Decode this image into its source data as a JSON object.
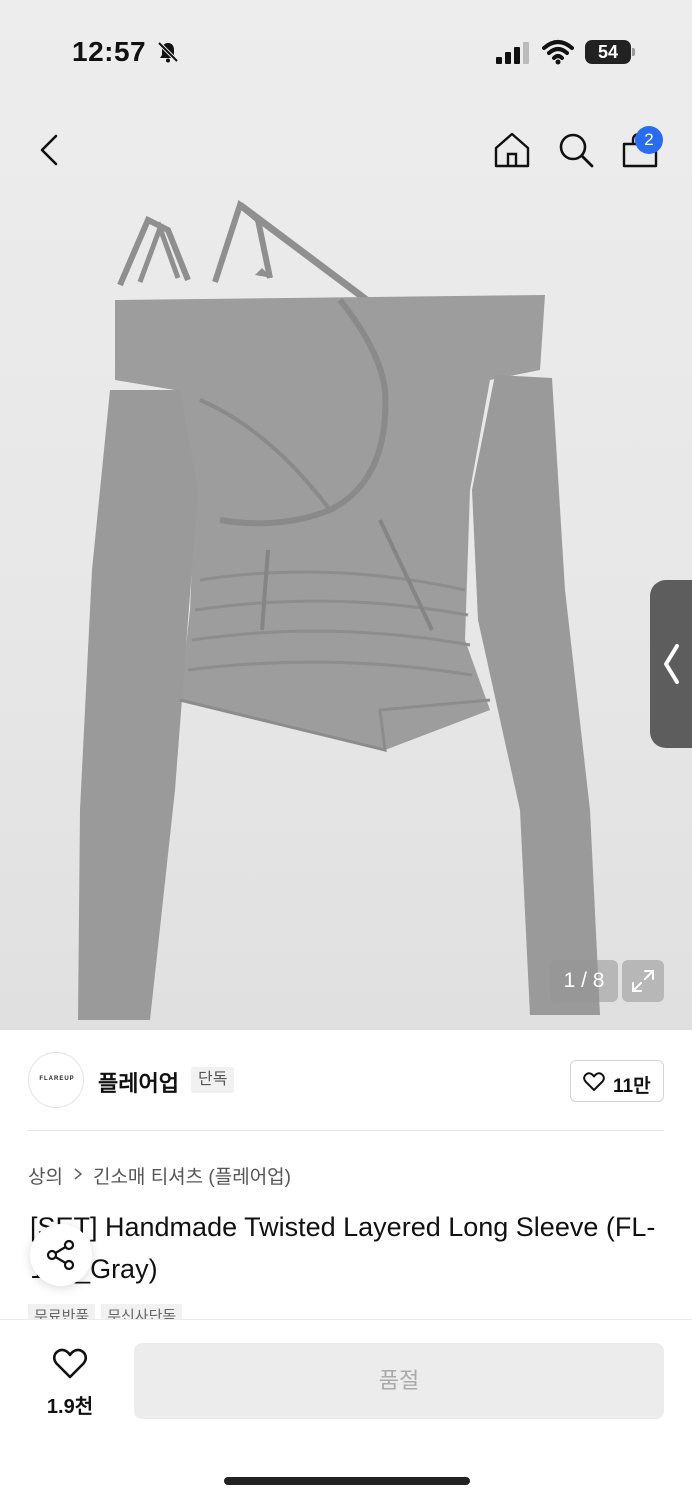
{
  "status_bar": {
    "time": "12:57",
    "battery": "54",
    "icons": [
      "bell-slash-icon",
      "signal-icon",
      "wifi-icon",
      "battery-icon"
    ]
  },
  "nav": {
    "icons": [
      "back-icon",
      "home-icon",
      "search-icon",
      "bag-icon"
    ],
    "cart_count": "2"
  },
  "gallery": {
    "counter": "1 / 8",
    "image_description_icon": "product-photo"
  },
  "brand": {
    "logo_text": "FLAREUP",
    "name": "플레어업",
    "badge": "단독",
    "likes": "11만"
  },
  "breadcrumb": {
    "category": "상의",
    "subcategory": "긴소매 티셔츠 (플레어업)"
  },
  "product": {
    "title": "[SET] Handmade Twisted Layered Long Sleeve (FL-138_Gray)",
    "tags": [
      "무료반품",
      "무신사단독"
    ]
  },
  "bottom_bar": {
    "wish_count": "1.9천",
    "buy_label": "품절"
  },
  "colors": {
    "accent_badge": "#2a6cf0",
    "garment_gray": "#9b9b9b",
    "soldout_bg": "#ececec"
  }
}
